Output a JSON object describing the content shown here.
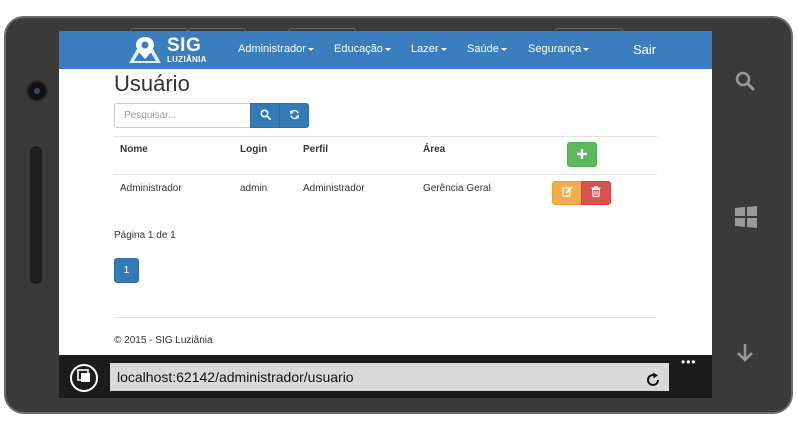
{
  "navbar": {
    "logo_title": "SIG",
    "logo_subtitle": "LUZIÂNIA",
    "menu": [
      {
        "label": "Administrador"
      },
      {
        "label": "Educação"
      },
      {
        "label": "Lazer"
      },
      {
        "label": "Saúde"
      },
      {
        "label": "Segurança"
      }
    ],
    "logout_label": "Sair"
  },
  "page": {
    "title": "Usuário",
    "search_placeholder": "Pesquisar...",
    "table": {
      "headers": [
        "Nome",
        "Login",
        "Perfil",
        "Área"
      ],
      "rows": [
        {
          "nome": "Administrador",
          "login": "admin",
          "perfil": "Administrador",
          "area": "Gerência Geral"
        }
      ]
    },
    "pagination_info": "Página 1 de 1",
    "current_page": "1",
    "footer": "© 2015 - SIG Luziânia"
  },
  "browser": {
    "url": "localhost:62142/administrador/usuario",
    "more_label": "•••"
  },
  "colors": {
    "primary": "#337ab7",
    "navbar": "#3a7ec0",
    "success": "#5cb85c",
    "warning": "#f0ad4e",
    "danger": "#d9534f"
  },
  "icons": [
    "search-icon",
    "refresh-icon",
    "plus-icon",
    "edit-icon",
    "trash-icon",
    "tabs-icon",
    "reload-icon",
    "hardware-search-icon",
    "windows-icon",
    "back-arrow-icon"
  ]
}
